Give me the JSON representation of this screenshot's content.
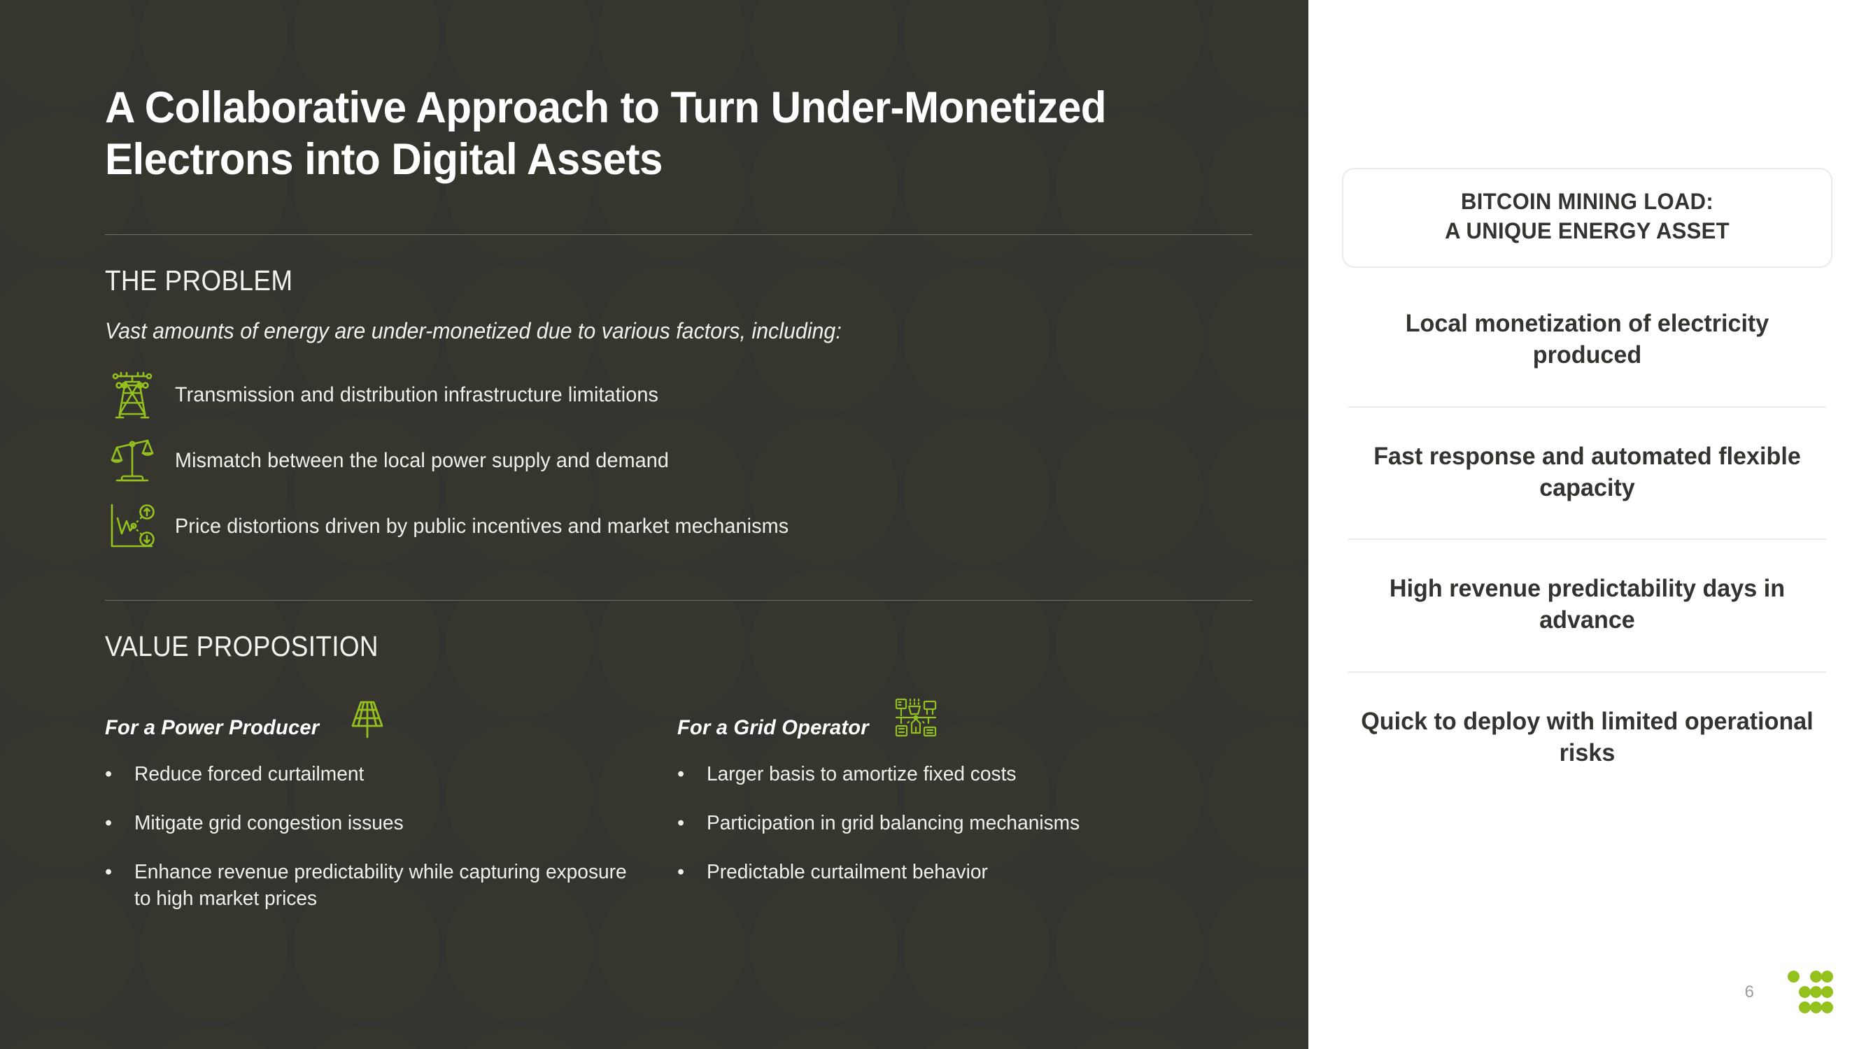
{
  "slide": {
    "title": "A Collaborative Approach to Turn Under-Monetized Electrons into Digital Assets",
    "page_number": "6",
    "accent_green": "#95c11f",
    "dark_bg": "#333330",
    "light_text": "#efefec"
  },
  "problem": {
    "heading": "THE PROBLEM",
    "subheading": "Vast amounts of energy are under-monetized due to various factors, including:",
    "items": [
      {
        "icon": "transmission-tower-icon",
        "text": "Transmission and distribution infrastructure limitations"
      },
      {
        "icon": "balance-scale-icon",
        "text": "Mismatch between the local power supply and demand"
      },
      {
        "icon": "price-distortion-chart-icon",
        "text": "Price distortions driven by public incentives and market mechanisms"
      }
    ]
  },
  "value_proposition": {
    "heading": "VALUE PROPOSITION",
    "columns": [
      {
        "title": "For a Power Producer",
        "icon": "solar-panel-icon",
        "bullets": [
          "Reduce forced curtailment",
          "Mitigate grid congestion issues",
          "Enhance revenue predictability while capturing exposure to high market prices"
        ]
      },
      {
        "title": "For a Grid Operator",
        "icon": "power-grid-network-icon",
        "bullets": [
          "Larger basis to amortize fixed costs",
          "Participation in grid balancing mechanisms",
          "Predictable curtailment behavior"
        ]
      }
    ]
  },
  "sidebar": {
    "box_title_line1": "BITCOIN MINING LOAD:",
    "box_title_line2": "A UNIQUE ENERGY ASSET",
    "benefits": [
      "Local monetization of electricity produced",
      "Fast response and automated flexible capacity",
      "High revenue predictability days in advance",
      "Quick to deploy with limited operational risks"
    ]
  }
}
